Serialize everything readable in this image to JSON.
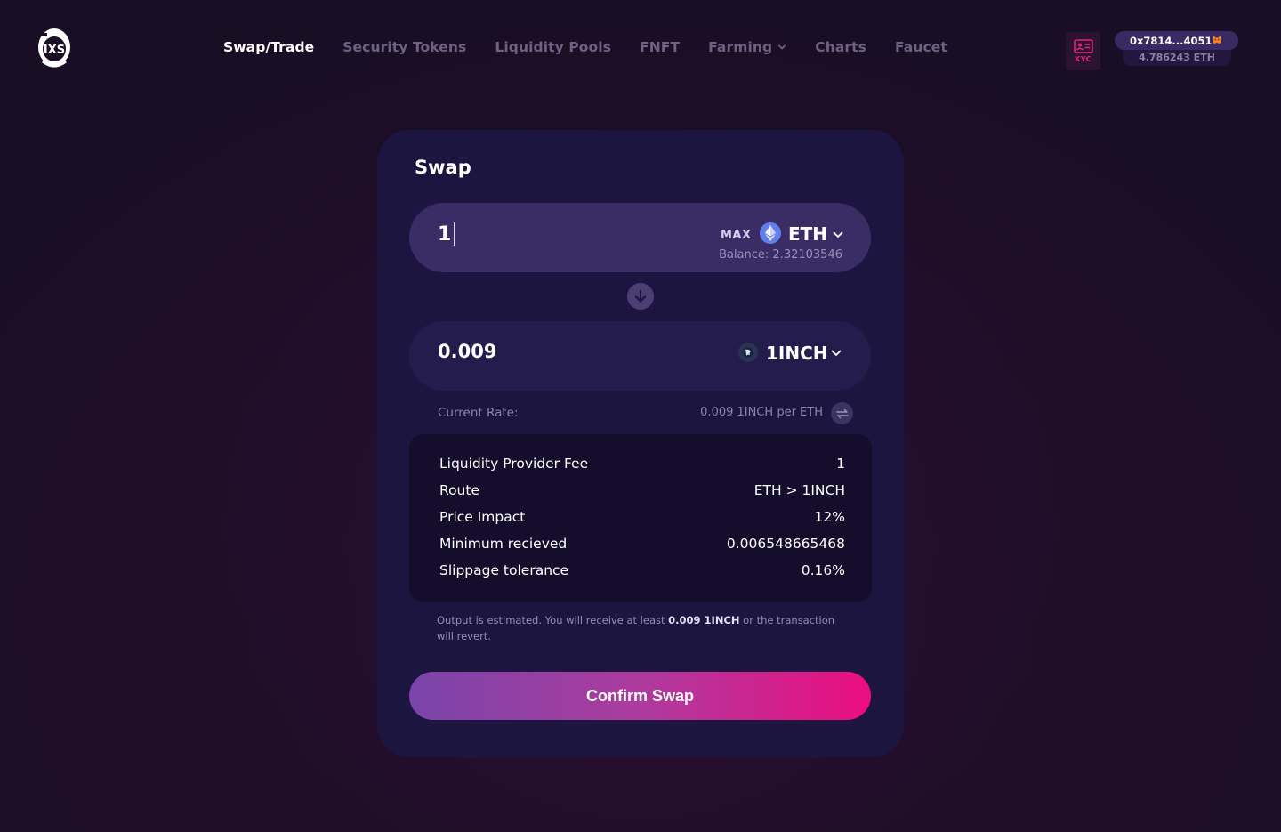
{
  "header": {
    "logo_text": "IXS",
    "nav": [
      {
        "label": "Swap/Trade",
        "active": true
      },
      {
        "label": "Security Tokens",
        "active": false
      },
      {
        "label": "Liquidity Pools",
        "active": false
      },
      {
        "label": "FNFT",
        "active": false
      },
      {
        "label": "Farming",
        "active": false,
        "dropdown": true
      },
      {
        "label": "Charts",
        "active": false
      },
      {
        "label": "Faucet",
        "active": false
      }
    ],
    "kyc_label": "KYC",
    "wallet": {
      "address": "0x7814...4051",
      "balance": "4.786243 ETH",
      "icon": "metamask-fox-icon"
    }
  },
  "swap": {
    "title": "Swap",
    "from": {
      "value": "1",
      "max_label": "MAX",
      "token": "ETH",
      "token_icon": "eth-icon",
      "balance": "Balance: 2.32103546"
    },
    "to": {
      "value": "0.009",
      "token": "1INCH",
      "token_icon": "1inch-icon"
    },
    "rate": {
      "label": "Current Rate:",
      "value": "0.009 1INCH per ETH"
    },
    "details": [
      {
        "label": "Liquidity Provider Fee",
        "value": "1"
      },
      {
        "label": "Route",
        "value": "ETH > 1INCH"
      },
      {
        "label": "Price Impact",
        "value": "12%"
      },
      {
        "label": "Minimum recieved",
        "value": "0.006548665468"
      },
      {
        "label": "Slippage tolerance",
        "value": "0.16%"
      }
    ],
    "note": {
      "prefix": "Output is estimated. You will receive at least ",
      "amount": "0.009 1INCH",
      "suffix": " or the transaction will revert."
    },
    "confirm_label": "Confirm Swap"
  },
  "colors": {
    "background": "#1a0e24",
    "card": "#1c1540",
    "accent_start": "#7a44aa",
    "accent_end": "#ec0d80",
    "kyc": "#e8227d"
  }
}
